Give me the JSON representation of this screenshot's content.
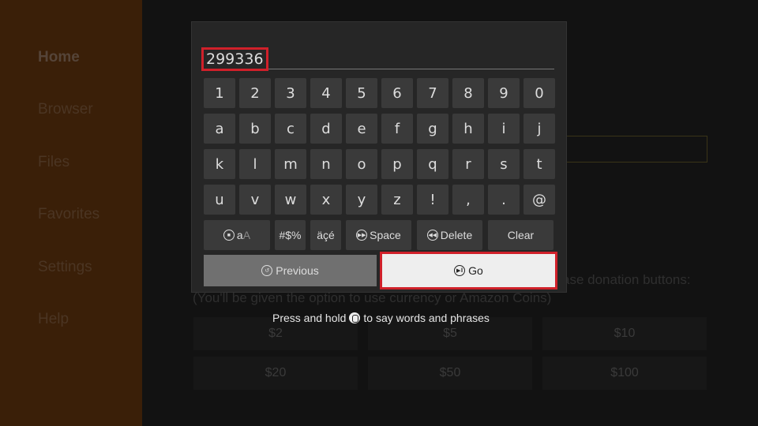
{
  "sidebar": {
    "items": [
      {
        "label": "Home",
        "active": true
      },
      {
        "label": "Browser"
      },
      {
        "label": "Files"
      },
      {
        "label": "Favorites"
      },
      {
        "label": "Settings"
      },
      {
        "label": "Help"
      }
    ]
  },
  "background": {
    "donation_text": "ase donation buttons:",
    "note_text": "(You'll be given the option to use currency or Amazon Coins)",
    "donations": [
      "$2",
      "$5",
      "$10",
      "$20",
      "$50",
      "$100"
    ]
  },
  "keyboard": {
    "input_value": "299336",
    "rows": [
      [
        "1",
        "2",
        "3",
        "4",
        "5",
        "6",
        "7",
        "8",
        "9",
        "0"
      ],
      [
        "a",
        "b",
        "c",
        "d",
        "e",
        "f",
        "g",
        "h",
        "i",
        "j"
      ],
      [
        "k",
        "l",
        "m",
        "n",
        "o",
        "p",
        "q",
        "r",
        "s",
        "t"
      ],
      [
        "u",
        "v",
        "w",
        "x",
        "y",
        "z",
        "!",
        ",",
        ".",
        "@"
      ]
    ],
    "case_label_lower": "a",
    "case_label_upper": "A",
    "symbols_label": "#$%",
    "accents_label": "äçé",
    "space_label": "Space",
    "delete_label": "Delete",
    "clear_label": "Clear",
    "previous_label": "Previous",
    "go_label": "Go"
  },
  "hint": {
    "before": "Press and hold",
    "after": "to say words and phrases"
  },
  "colors": {
    "accent": "#d0202a",
    "sidebar": "#3a1f08"
  }
}
